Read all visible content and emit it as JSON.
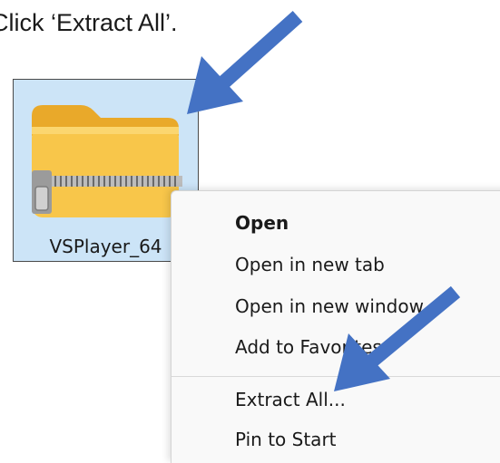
{
  "instruction": "Click ‘Extract All’.",
  "file": {
    "name": "VSPlayer_64",
    "icon": "zip-folder-icon"
  },
  "context_menu": {
    "items": [
      {
        "label": "Open"
      },
      {
        "label": "Open in new tab"
      },
      {
        "label": "Open in new window"
      },
      {
        "label": "Add to Favorites"
      },
      {
        "label": "Extract All..."
      },
      {
        "label": "Pin to Start"
      }
    ]
  },
  "colors": {
    "arrow": "#4472c4",
    "selection": "#cce4f7",
    "folder": "#f8c64a"
  }
}
